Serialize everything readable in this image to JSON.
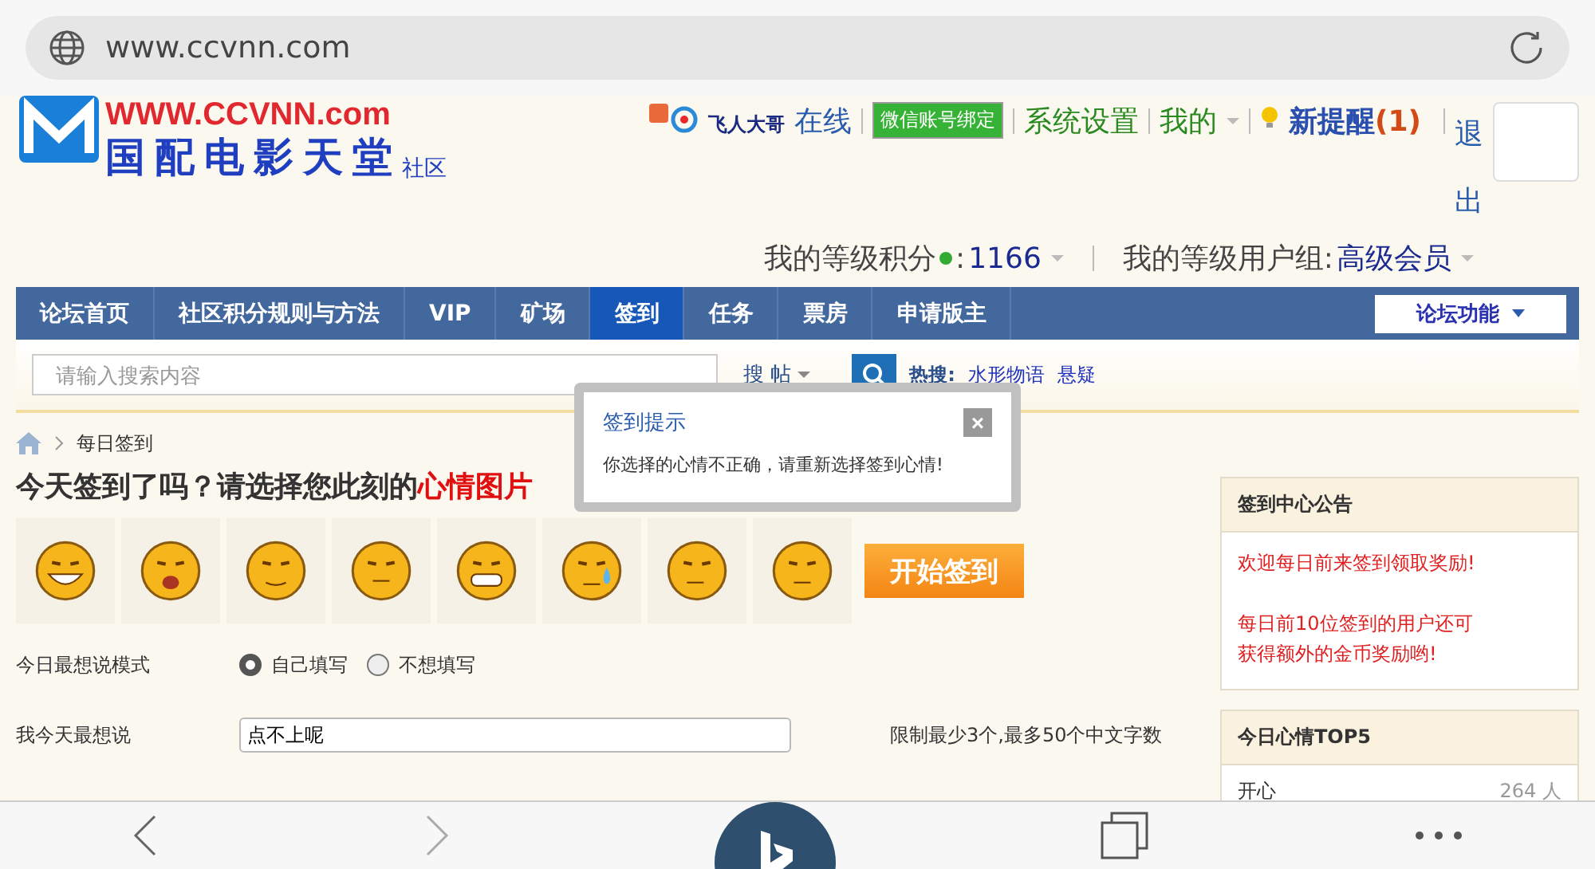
{
  "browser": {
    "url": "www.ccvnn.com"
  },
  "logo": {
    "domain": "WWW.CCVNN.com",
    "name": "国配电影天堂",
    "suffix": "社区"
  },
  "user_bar": {
    "username": "飞人大哥",
    "status": "在线",
    "wechat": "微信账号绑定",
    "settings": "系统设置",
    "mine": "我的",
    "notify": "新提醒",
    "notify_count": "(1)",
    "logout": "退出"
  },
  "stats": [
    {
      "label": "我的等级积分",
      "colon": ":",
      "value": "1166"
    },
    {
      "label": "我的等级用户组:",
      "value": "高级会员"
    }
  ],
  "nav": [
    {
      "label": "论坛首页",
      "selected": false
    },
    {
      "label": "社区积分规则与方法",
      "selected": false
    },
    {
      "label": "VIP",
      "selected": false
    },
    {
      "label": "矿场",
      "selected": false
    },
    {
      "label": "签到",
      "selected": true
    },
    {
      "label": "任务",
      "selected": false
    },
    {
      "label": "票房",
      "selected": false
    },
    {
      "label": "申请版主",
      "selected": false
    }
  ],
  "forum_menu": "论坛功能",
  "search": {
    "placeholder": "请输入搜索内容",
    "scope": "搜 帖",
    "hot_label": "热搜:",
    "hot": [
      "水形物语",
      "悬疑"
    ]
  },
  "breadcrumb": "每日签到",
  "heading": {
    "text": "今天签到了吗？请选择您此刻的",
    "highlight": "心情图片"
  },
  "start_button": "开始签到",
  "form": {
    "mode_label": "今日最想说模式",
    "modes": [
      {
        "label": "自己填写",
        "selected": true
      },
      {
        "label": "不想填写",
        "selected": false
      }
    ],
    "say_label": "我今天最想说",
    "say_value": "点不上呢",
    "say_hint": "限制最少3个,最多50个中文字数"
  },
  "announcement": {
    "title": "签到中心公告",
    "lines": [
      "欢迎每日前来签到领取奖励!",
      "每日前10位签到的用户还可",
      "获得额外的金币奖励哟!"
    ]
  },
  "top5": {
    "title": "今日心情TOP5",
    "rows": [
      {
        "mood": "开心",
        "count": "264 人"
      }
    ]
  },
  "dialog": {
    "title": "签到提示",
    "message": "你选择的心情不正确，请重新选择签到心情!",
    "close": "×"
  }
}
